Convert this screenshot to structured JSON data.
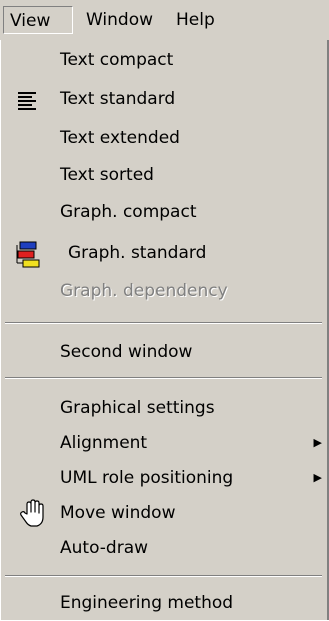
{
  "menubar": {
    "view": "View",
    "window": "Window",
    "help": "Help"
  },
  "menu": {
    "text_compact": "Text compact",
    "text_standard": "Text standard",
    "text_extended": "Text extended",
    "text_sorted": "Text sorted",
    "graph_compact": "Graph. compact",
    "graph_standard": "Graph. standard",
    "graph_dependency": "Graph. dependency",
    "second_window": "Second window",
    "graphical_settings": "Graphical settings",
    "alignment": "Alignment",
    "uml_role_positioning": "UML role positioning",
    "move_window": "Move window",
    "auto_draw": "Auto-draw",
    "engineering_method": "Engineering method"
  },
  "icons": {
    "text_standard": "text-lines-icon",
    "graph_standard": "diagram-boxes-icon",
    "move_window": "hand-icon",
    "submenu": "submenu-arrow-icon"
  },
  "colors": {
    "menu_background": "#d4d0c8",
    "text": "#000000",
    "disabled_text": "#808080",
    "diagram_blue": "#1f3fbf",
    "diagram_red": "#e02020",
    "diagram_yellow": "#f0e020"
  }
}
